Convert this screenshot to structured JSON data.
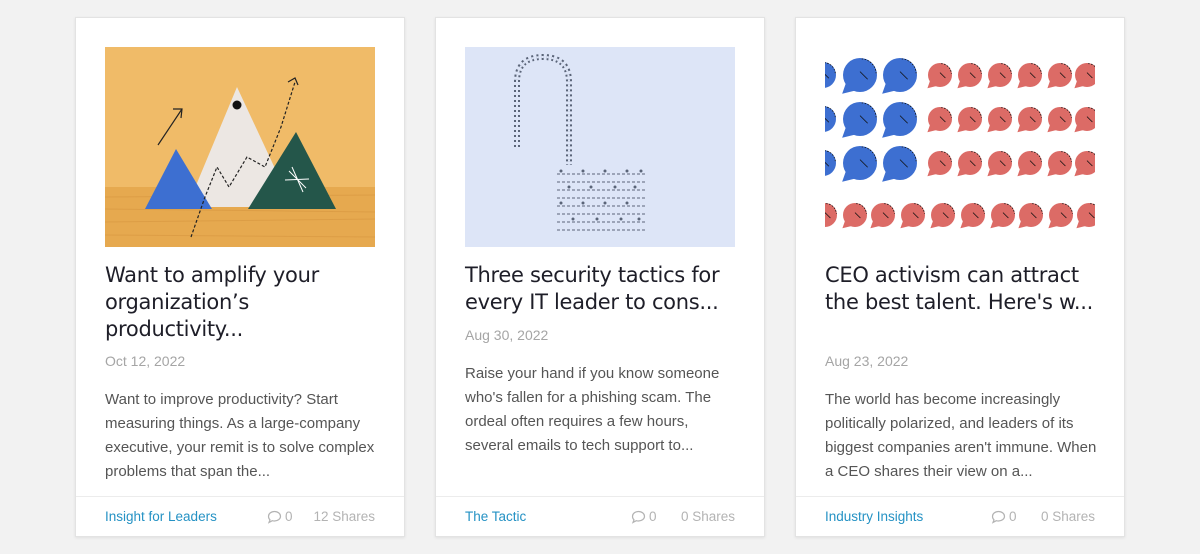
{
  "cards": [
    {
      "image_icon": "mountains-illustration",
      "title": "Want to amplify your organization’s productivity...",
      "date": "Oct 12, 2022",
      "excerpt": "Want to improve productivity? Start measuring things. As a large-company executive, your remit is to solve complex problems that span the...",
      "category": "Insight for Leaders",
      "comments": "0",
      "shares": "12 Shares"
    },
    {
      "image_icon": "open-padlock-illustration",
      "title": "Three security tactics for every IT leader to cons...",
      "date": "Aug 30, 2022",
      "excerpt": "Raise your hand if you know someone who's fallen for a phishing scam. The ordeal often requires a few hours, several emails to tech support to...",
      "category": "The Tactic",
      "comments": "0",
      "shares": "0 Shares"
    },
    {
      "image_icon": "speech-bubbles-illustration",
      "title": "CEO activism can attract the best talent. Here's w...",
      "date": "Aug 23, 2022",
      "excerpt": "The world has become increasingly politically polarized, and leaders of its biggest companies aren't immune. When a CEO shares their view on a...",
      "category": "Industry Insights",
      "comments": "0",
      "shares": "0 Shares"
    }
  ],
  "colors": {
    "background": "#f2f2f2",
    "category_link": "#2592c4",
    "muted": "#b3b3b3",
    "mountains_bg": "#f0bb68",
    "lock_bg": "#dde5f7",
    "bubble_blue": "#3d6fd1",
    "bubble_red": "#dc6b66"
  }
}
